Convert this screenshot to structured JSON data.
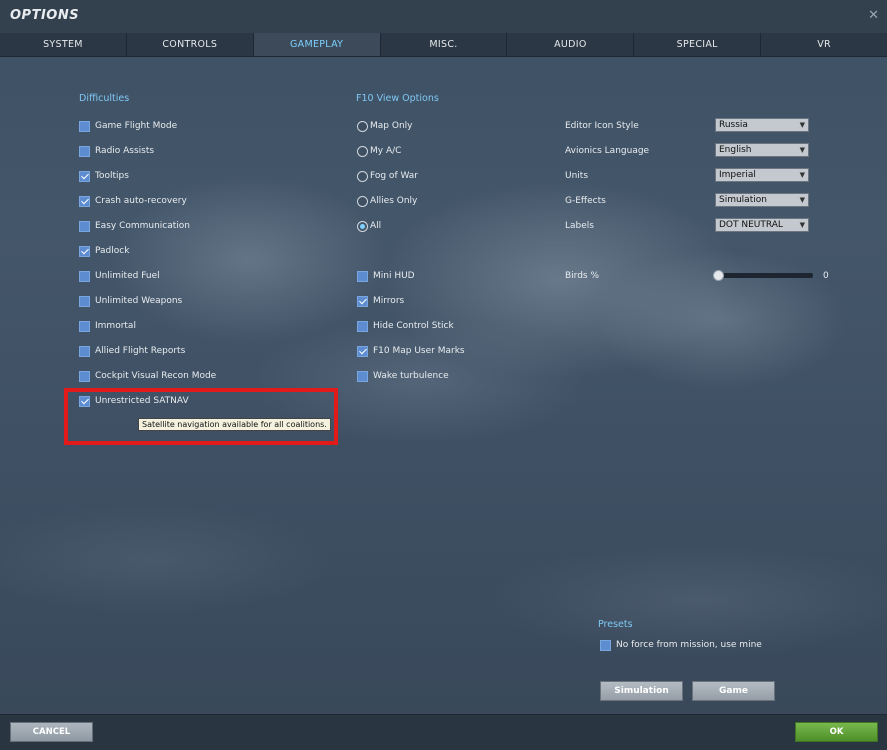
{
  "window": {
    "title": "OPTIONS",
    "close_glyph": "✕"
  },
  "tabs": [
    {
      "label": "SYSTEM"
    },
    {
      "label": "CONTROLS"
    },
    {
      "label": "GAMEPLAY"
    },
    {
      "label": "MISC."
    },
    {
      "label": "AUDIO"
    },
    {
      "label": "SPECIAL"
    },
    {
      "label": "VR"
    }
  ],
  "active_tab": "GAMEPLAY",
  "difficulties": {
    "title": "Difficulties",
    "items": [
      {
        "label": "Game Flight Mode",
        "checked": false
      },
      {
        "label": "Radio Assists",
        "checked": false
      },
      {
        "label": "Tooltips",
        "checked": true
      },
      {
        "label": "Crash auto-recovery",
        "checked": true
      },
      {
        "label": "Easy Communication",
        "checked": false
      },
      {
        "label": "Padlock",
        "checked": true
      },
      {
        "label": "Unlimited Fuel",
        "checked": false
      },
      {
        "label": "Unlimited Weapons",
        "checked": false
      },
      {
        "label": "Immortal",
        "checked": false
      },
      {
        "label": "Allied Flight Reports",
        "checked": false
      },
      {
        "label": "Cockpit Visual Recon Mode",
        "checked": false
      },
      {
        "label": "Unrestricted SATNAV",
        "checked": true
      }
    ]
  },
  "tooltip": {
    "text": "Satellite navigation available for all coalitions."
  },
  "f10_view": {
    "title": "F10 View Options",
    "options": [
      {
        "label": "Map Only",
        "selected": false
      },
      {
        "label": "My A/C",
        "selected": false
      },
      {
        "label": "Fog of War",
        "selected": false
      },
      {
        "label": "Allies Only",
        "selected": false
      },
      {
        "label": "All",
        "selected": true
      }
    ]
  },
  "misc_checks": [
    {
      "label": "Mini HUD",
      "checked": false
    },
    {
      "label": "Mirrors",
      "checked": true
    },
    {
      "label": "Hide Control Stick",
      "checked": false
    },
    {
      "label": "F10 Map User Marks",
      "checked": true
    },
    {
      "label": "Wake turbulence",
      "checked": false
    }
  ],
  "dropdowns": [
    {
      "label": "Editor Icon Style",
      "value": "Russia"
    },
    {
      "label": "Avionics Language",
      "value": "English"
    },
    {
      "label": "Units",
      "value": "Imperial"
    },
    {
      "label": "G-Effects",
      "value": "Simulation"
    },
    {
      "label": "Labels",
      "value": "DOT NEUTRAL"
    }
  ],
  "birds": {
    "label": "Birds %",
    "value": "0"
  },
  "presets": {
    "title": "Presets",
    "no_force_label": "No force from mission, use mine",
    "no_force_checked": false,
    "simulation_label": "Simulation",
    "game_label": "Game"
  },
  "footer": {
    "cancel_label": "CANCEL",
    "ok_label": "OK"
  },
  "colors": {
    "accent": "#7fc8f5",
    "highlight": "#e31a1a",
    "ok": "#5a9d33"
  }
}
